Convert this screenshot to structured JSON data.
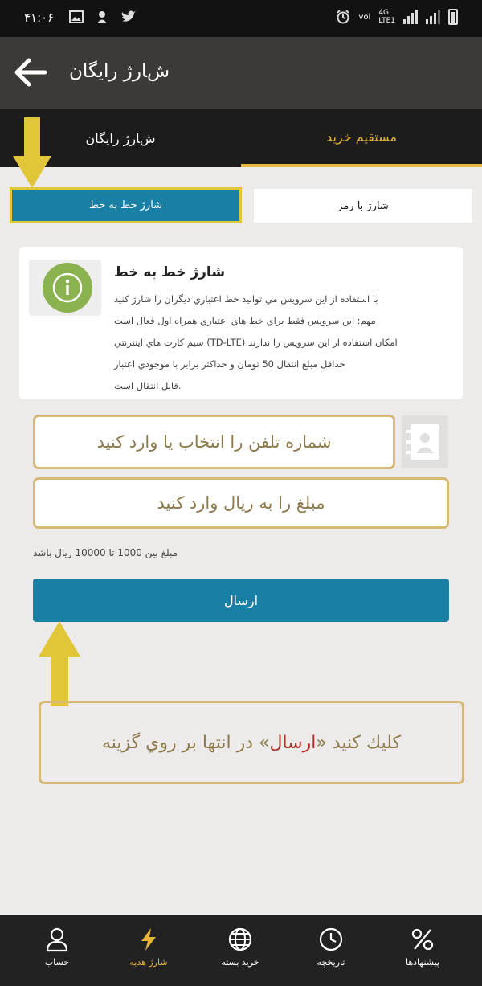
{
  "status_bar": {
    "time": "۴۱:۰۶",
    "network": "4G",
    "network_sub": "LTE1",
    "data_speed": "vol"
  },
  "header": {
    "title": "ﺵﺎﺭژ ﺭﺍﻳﮕﺎﻥ"
  },
  "tabs": [
    {
      "label": "ﺵﺎﺭژ ﺭﺍﻳﮕﺎﻥ"
    },
    {
      "label": "ﻣﺴﺘﻘﻴﻢ ﺧﺮﻳﺪ"
    }
  ],
  "segments": {
    "left_label": "ﺷﺎﺭژ ﺧﻂ ﺑﻪ ﺧﻂ",
    "right_label": "ﺷﺎﺭژ ﺑﺎ ﺭﻣﺰ"
  },
  "info_card": {
    "title": "ﺷﺎﺭژ ﺧﻂ ﺑﻪ ﺧﻂ",
    "body_lines": [
      "ﺑﺎ ﺍﺳﺘﻔﺎﺩﻩ ﺍﺯ ﺍﻳﻦ ﺳﺮﻭﻳﺲ ﻣﻲ ﺗﻮﺍﻧﻴﺪ ﺧﻂ ﺍﻋﺘﺒﺎﺭﻱ ﺩﻳﮕﺮﺍﻥ ﺭﺍ ﺷﺎﺭژ ﻛﻨﻴﺪ",
      "ﻣﻬﻢ: ﺍﻳﻦ ﺳﺮﻭﻳﺲ ﻓﻘﻂ ﺑﺮﺍﻱ ﺧﻂ ﻫﺎﻱ ﺍﻋﺘﺒﺎﺭﻱ ﻫﻤﺮﺍﻩ ﺍﻭﻝ ﻓﻌﺎﻝ ﺍﺳﺖ",
      "ﺳﻴﻢ ﻛﺎﺭﺕ ﻫﺎﻱ ﺍﻳﻨﺘﺮﻧﺘﻲ (TD-LTE) ﺍﻣﻜﺎﻥ ﺍﺳﺘﻔﺎﺩﻩ ﺍﺯ ﺍﻳﻦ ﺳﺮﻭﻳﺲ ﺭﺍ ﻧﺪﺍﺭﻧﺪ",
      "ﺣﺪﺍﻗﻞ ﻣﺒﻠﻎ ﺍﻧﺘﻘﺎﻝ 50 ﺗﻮﻣﺎﻥ ﻭ ﺣﺪﺍﻛﺜﺮ ﺑﺮﺍﺑﺮ ﺑﺎ ﻣﻮﺟﻮﺩﻱ ﺍﻋﺘﺒﺎﺭ",
      "ﻗﺎﺑﻞ ﺍﻧﺘﻘﺎﻝ ﺍﺳﺖ."
    ]
  },
  "form": {
    "contact_placeholder": "ﺷﻤﺎﺭﻩ ﺗﻠﻔﻦ ﺭﺍ ﺍﻧﺘﺨﺎﺏ ﻳﺎ ﻭﺍﺭﺩ ﻛﻨﻴﺪ",
    "amount_placeholder": "ﻣﺒﻠﻎ ﺭﺍ ﺑﻪ ﺭﻳﺎﻝ ﻭﺍﺭﺩ ﻛﻨﻴﺪ",
    "amount_hint": "ﻣﺒﻠﻎ ﺑﻴﻦ 1000 ﺗﺎ 10000 ﺭﻳﺎﻝ ﺑﺎﺷﺪ",
    "submit_label": "ﺍﺭﺳﺎﻝ"
  },
  "instruction": {
    "before": "ﺩﺭ ﺍﻧﺘﻬﺎ ﺑﺮ ﺭﻭﻱ ﮔﺰﻳﻨﻪ «",
    "highlight": "ﺍﺭﺳﺎﻝ",
    "after": "» ﻛﻠﻴﻚ ﻛﻨﻴﺪ"
  },
  "bottom_nav": [
    {
      "label": "ﭘﻴﺸﻨﻬﺎﺩﻫﺎ",
      "icon": "percent-icon"
    },
    {
      "label": "ﺗﺎﺭﻳﺨﭽﻪ",
      "icon": "clock-icon"
    },
    {
      "label": "ﺧﺮﻳﺪ ﺑﺴﺘﻪ",
      "icon": "globe-icon"
    },
    {
      "label": "ﺷﺎﺭژ ﻫﺪﻳﻪ",
      "icon": "lightning-icon"
    },
    {
      "label": "ﺣﺴﺎﺏ",
      "icon": "person-icon"
    }
  ],
  "colors": {
    "header_bg": "#3c3a37",
    "tabbar_bg": "#1c1c1c",
    "accent_gold": "#e8b53c",
    "primary_blue": "#1a7fa5",
    "annotation_border": "#d6b774",
    "annotation_arrow": "#e2c63a",
    "info_icon_green": "#8ab24f",
    "highlight_red": "#b0312c"
  }
}
